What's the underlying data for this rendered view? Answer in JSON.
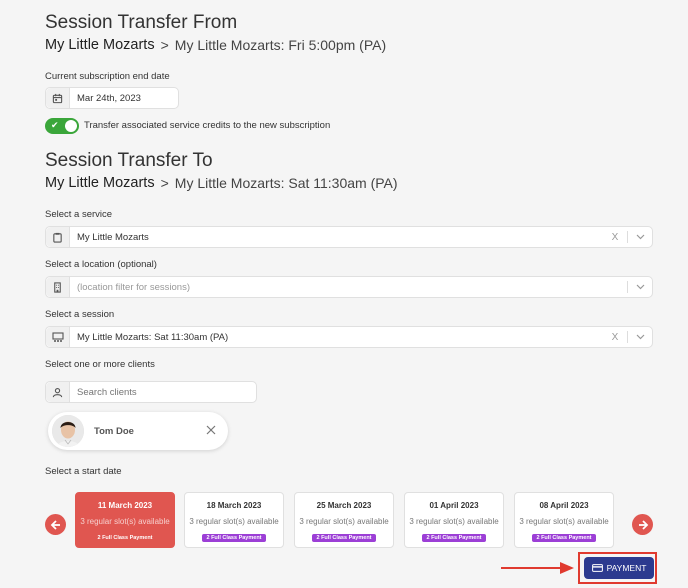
{
  "from": {
    "title": "Session Transfer From",
    "program": "My Little Mozarts",
    "separator": ">",
    "session": "My Little Mozarts: Fri 5:00pm (PA)",
    "end_date_label": "Current subscription end date",
    "end_date_value": "Mar 24th, 2023",
    "transfer_toggle_label": "Transfer associated service credits to the new subscription",
    "transfer_toggle_on": true
  },
  "to": {
    "title": "Session Transfer To",
    "program": "My Little Mozarts",
    "separator": ">",
    "session": "My Little Mozarts: Sat 11:30am (PA)"
  },
  "service": {
    "label": "Select a service",
    "value": "My Little Mozarts",
    "clear": "X"
  },
  "location": {
    "label": "Select a location (optional)",
    "placeholder": "(location filter for sessions)"
  },
  "session_select": {
    "label": "Select a session",
    "value": "My Little Mozarts: Sat 11:30am (PA)",
    "clear": "X"
  },
  "clients": {
    "label": "Select one or more clients",
    "search_placeholder": "Search clients",
    "selected": [
      {
        "name": "Tom Doe"
      }
    ]
  },
  "start_date": {
    "label": "Select a start date",
    "cards": [
      {
        "date": "11 March 2023",
        "availability": "3 regular slot(s) available",
        "badge": "2 Full Class Payment",
        "selected": true
      },
      {
        "date": "18 March 2023",
        "availability": "3 regular slot(s) available",
        "badge": "2 Full Class Payment",
        "selected": false
      },
      {
        "date": "25 March 2023",
        "availability": "3 regular slot(s) available",
        "badge": "2 Full Class Payment",
        "selected": false
      },
      {
        "date": "01 April 2023",
        "availability": "3 regular slot(s) available",
        "badge": "2 Full Class Payment",
        "selected": false
      },
      {
        "date": "08 April 2023",
        "availability": "3 regular slot(s) available",
        "badge": "2 Full Class Payment",
        "selected": false
      }
    ]
  },
  "payment_button": {
    "label": "PAYMENT",
    "icon": "credit-card-icon"
  },
  "colors": {
    "accent_red": "#e05650",
    "toggle_green": "#3aa63a",
    "badge_purple": "#9c3fd6",
    "payment_blue": "#2c3a8f",
    "highlight_red": "#e03a2f"
  }
}
